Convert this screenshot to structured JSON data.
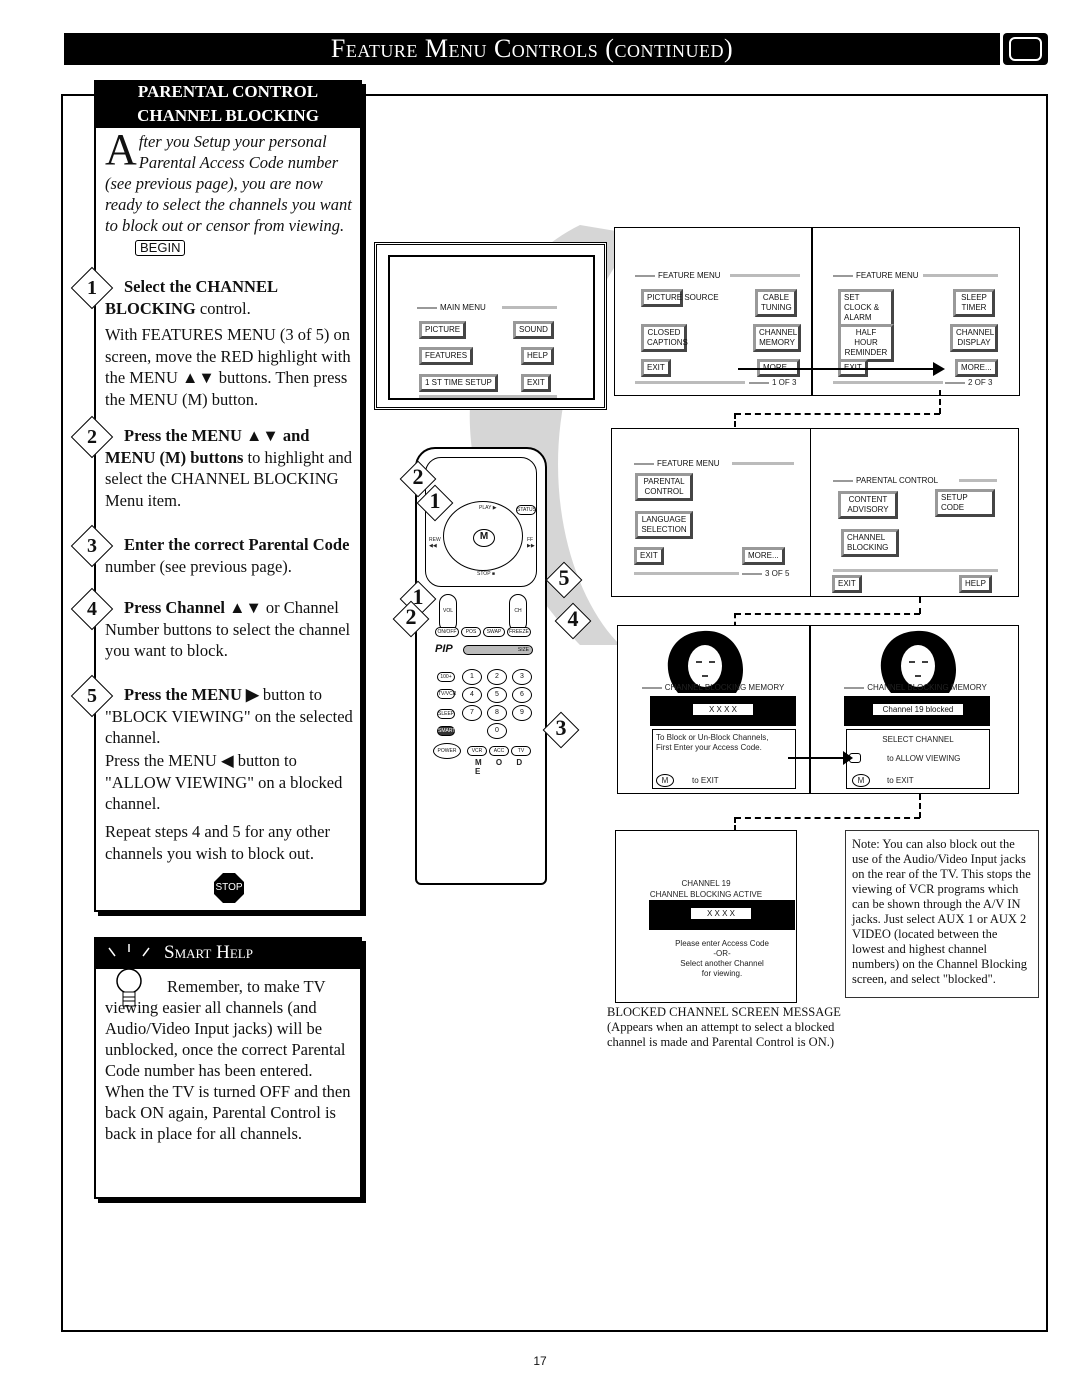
{
  "header": {
    "title": "Feature Menu Controls (continued)"
  },
  "left": {
    "heading1": "PARENTAL CONTROL",
    "heading2": "CHANNEL BLOCKING",
    "intro_dropcap": "A",
    "intro": "fter you Setup your personal Parental Access Code number (see previous page), you are now ready to select the channels you want to block out or censor from viewing.",
    "begin": "BEGIN",
    "steps": [
      {
        "num": "1",
        "bold": "Select the CHANNEL BLOCKING",
        "rest": " control.",
        "extra": "With FEATURES MENU (3 of 5) on screen, move the RED highlight with the MENU ▲▼ buttons. Then press the MENU (M) button."
      },
      {
        "num": "2",
        "bold": "Press the MENU ▲▼ and MENU (M) buttons",
        "rest": " to highlight and select the CHANNEL BLOCKING Menu item."
      },
      {
        "num": "3",
        "bold": "Enter the correct Parental Code",
        "rest": " number (see previous page)."
      },
      {
        "num": "4",
        "bold": "Press Channel ▲▼",
        "rest": " or Channel Number buttons to select the channel you want to block."
      },
      {
        "num": "5",
        "bold": "Press the MENU ▶",
        "rest": " button to \"BLOCK VIEWING\" on the selected channel.",
        "extra": "Press the MENU ◀ button to \"ALLOW VIEWING\" on a blocked channel."
      }
    ],
    "repeat": "Repeat steps 4 and 5 for any other channels you wish to block out.",
    "stop": "STOP"
  },
  "smart_help": {
    "title": "Smart Help",
    "text1": "Remember, to make TV viewing easier all channels (and Audio/Video Input jacks) will be unblocked, once the correct Parental Code number has been entered.",
    "text2": "When the TV is turned OFF and then back ON again, Parental Control is back in place for all channels."
  },
  "screens": {
    "main": {
      "title": "MAIN MENU",
      "picture": "PICTURE",
      "sound": "SOUND",
      "features": "FEATURES",
      "help": "HELP",
      "setup": "1 ST TIME SETUP",
      "exit": "EXIT"
    },
    "f1": {
      "title": "FEATURE MENU",
      "a": "PICTURE SOURCE",
      "b": "CABLE TUNING",
      "c": "CLOSED CAPTIONS",
      "d": "CHANNEL MEMORY",
      "exit": "EXIT",
      "more": "MORE...",
      "page": "1 OF 3"
    },
    "f2": {
      "title": "FEATURE MENU",
      "a": "SET CLOCK & ALARM TIMER",
      "b": "SLEEP TIMER",
      "c": "HALF HOUR REMINDER",
      "d": "CHANNEL DISPLAY",
      "exit": "EXIT",
      "more": "MORE...",
      "page": "2 OF 3"
    },
    "f3": {
      "title": "FEATURE MENU",
      "a": "PARENTAL CONTROL",
      "b": "LANGUAGE SELECTION",
      "exit": "EXIT",
      "more": "MORE...",
      "page": "3 OF 5"
    },
    "pc": {
      "title": "PARENTAL CONTROL",
      "a": "CONTENT ADVISORY",
      "b": "SETUP CODE",
      "c": "CHANNEL BLOCKING",
      "exit": "EXIT",
      "help": "HELP"
    },
    "cbm1": {
      "title": "CHANNEL BLOCKING MEMORY",
      "code": "X X X X",
      "msg": "To Block or Un-Block Channels, First Enter your Access Code.",
      "m": "M",
      "exit": "to EXIT"
    },
    "cbm2": {
      "title": "CHANNEL BLOCKING MEMORY",
      "code": "Channel 19 blocked",
      "select": "SELECT CHANNEL",
      "allow": "to ALLOW VIEWING",
      "m": "M",
      "exit": "to EXIT"
    },
    "blocked": {
      "line1": "CHANNEL 19",
      "line2": "CHANNEL BLOCKING ACTIVE",
      "code": "X X X X",
      "msg1": "Please enter Access Code",
      "msg2": "-OR-",
      "msg3": "Select another Channel",
      "msg4": "for viewing."
    }
  },
  "remote": {
    "play": "PLAY ▶",
    "status": "STATUS",
    "rew": "REW ◀◀",
    "ff": "FF ▶▶",
    "stop": "STOP ■",
    "m": "M",
    "vol": "VOL",
    "ch": "CH",
    "pip_buttons": [
      "ON/OFF",
      "POS",
      "SWAP",
      "FREEZE"
    ],
    "pip": "PIP",
    "size": "SIZE",
    "keys": [
      "1",
      "2",
      "3",
      "4",
      "5",
      "6",
      "7",
      "8",
      "9",
      "0"
    ],
    "side": [
      "100+",
      "TV/VCR",
      "SLEEP",
      "SMART",
      "POWER"
    ],
    "mode": [
      "VCR",
      "ACC",
      "TV"
    ],
    "mode_label": "M O D E",
    "callouts": [
      "2",
      "1",
      "1",
      "2",
      "5",
      "4",
      "3"
    ]
  },
  "caption": {
    "title": "BLOCKED CHANNEL SCREEN MESSAGE",
    "text": "(Appears when an attempt to select a blocked channel is made and Parental Control is ON.)"
  },
  "note": "Note: You can also block out the use of the Audio/Video Input jacks on the rear of the TV. This stops the viewing of VCR programs which can be shown through the A/V IN jacks. Just select AUX 1 or AUX 2 VIDEO (located between the lowest and highest channel numbers) on the Channel Blocking screen, and select \"blocked\".",
  "page_number": "17"
}
